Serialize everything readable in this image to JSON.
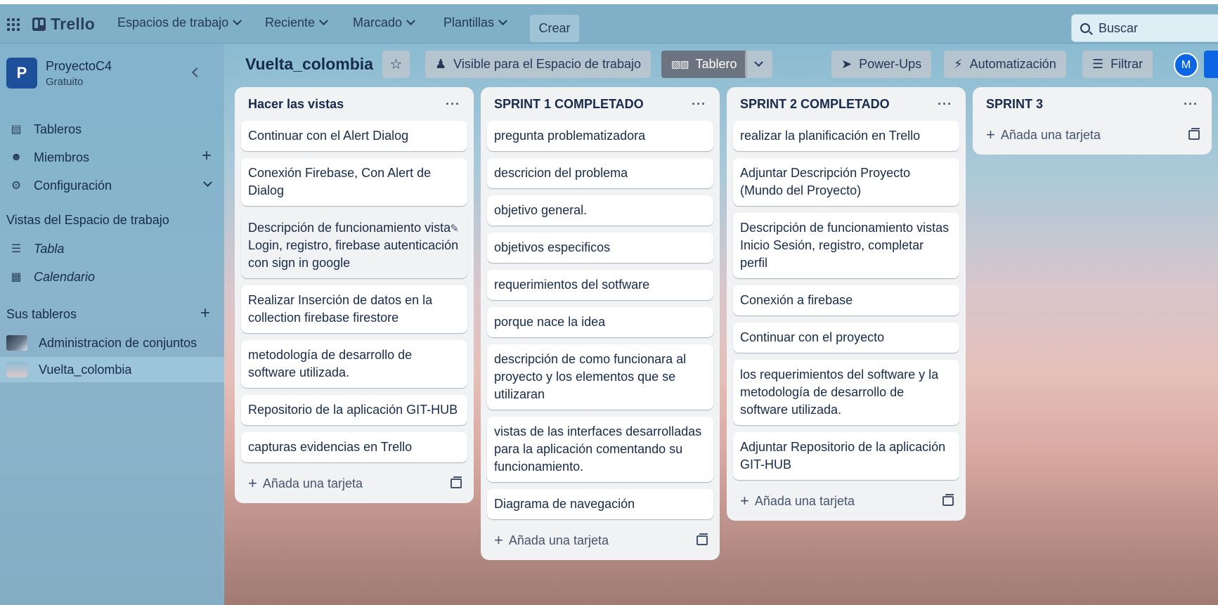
{
  "header": {
    "brand": "Trello",
    "nav": [
      "Espacios de trabajo",
      "Reciente",
      "Marcado",
      "Plantillas"
    ],
    "create_label": "Crear",
    "search_placeholder": "Buscar"
  },
  "sidebar": {
    "workspace_initial": "P",
    "workspace_name": "ProyectoC4",
    "workspace_plan": "Gratuito",
    "items": [
      {
        "label": "Tableros",
        "icon": "board-icon"
      },
      {
        "label": "Miembros",
        "icon": "person-icon"
      },
      {
        "label": "Configuración",
        "icon": "gear-icon"
      }
    ],
    "views_heading": "Vistas del Espacio de trabajo",
    "views": [
      {
        "label": "Tabla",
        "icon": "table-icon"
      },
      {
        "label": "Calendario",
        "icon": "calendar-icon"
      }
    ],
    "boards_heading": "Sus tableros",
    "boards": [
      {
        "label": "Administracion de conjuntos",
        "active": false
      },
      {
        "label": "Vuelta_colombia",
        "active": true
      }
    ]
  },
  "board_bar": {
    "title": "Vuelta_colombia",
    "visibility_label": "Visible para el Espacio de trabajo",
    "view_label": "Tablero",
    "powerups_label": "Power-Ups",
    "automation_label": "Automatización",
    "filter_label": "Filtrar",
    "avatar_initial": "M"
  },
  "lists": [
    {
      "title": "Hacer las vistas",
      "cards": [
        "Continuar con el Alert Dialog",
        "Conexión Firebase, Con Alert de Dialog",
        "Descripción de funcionamiento vista Login, registro, firebase autenticación con sign in google",
        "Realizar Inserción de datos en la collection firebase firestore",
        "metodología de desarrollo de software utilizada.",
        "Repositorio de la aplicación GIT-HUB",
        "capturas evidencias en Trello"
      ],
      "add_label": "Añada una tarjeta"
    },
    {
      "title": "SPRINT 1 COMPLETADO",
      "cards": [
        "pregunta problematizadora",
        "descricion del problema",
        "objetivo general.",
        "objetivos especificos",
        "requerimientos del sotfware",
        "porque nace la idea",
        "descripción de como funcionara al proyecto y los elementos que se utilizaran",
        "vistas de las interfaces desarrolladas para la aplicación comentando su funcionamiento.",
        "Diagrama de navegación"
      ],
      "add_label": "Añada una tarjeta"
    },
    {
      "title": "SPRINT 2 COMPLETADO",
      "cards": [
        "realizar la planificación en Trello",
        "Adjuntar Descripción Proyecto (Mundo del Proyecto)",
        "Descripción de funcionamiento vistas Inicio Sesión, registro, completar perfil",
        "Conexión a firebase",
        "Continuar con el proyecto",
        "los requerimientos del software y la metodología de desarrollo de software utilizada.",
        "Adjuntar Repositorio de la aplicación GIT-HUB"
      ],
      "add_label": "Añada una tarjeta"
    },
    {
      "title": "SPRINT 3",
      "cards": [],
      "add_label": "Añada una tarjeta"
    }
  ]
}
